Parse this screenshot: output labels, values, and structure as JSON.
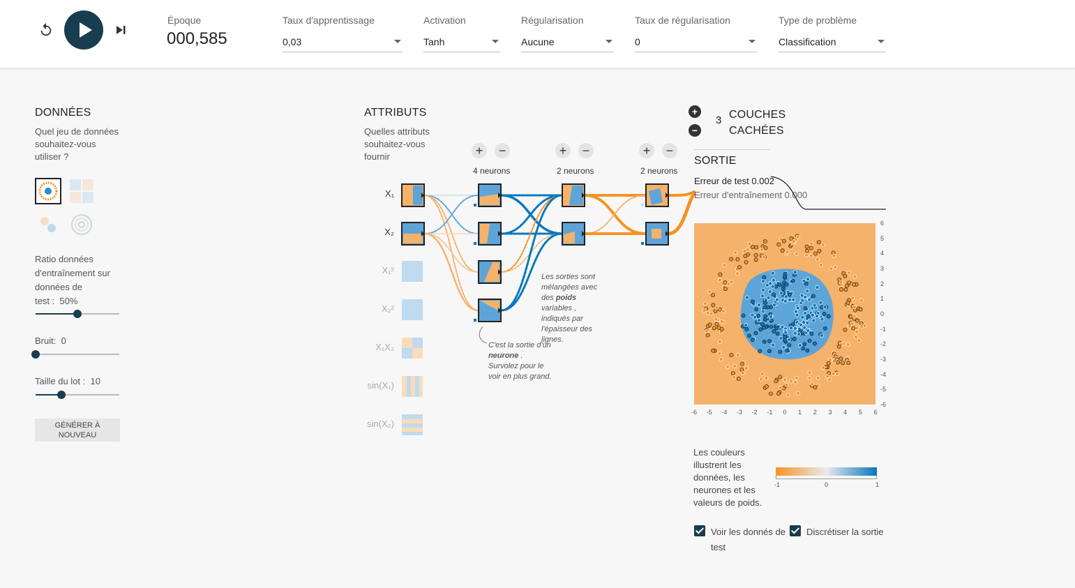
{
  "controls": {
    "epoch_label": "Époque",
    "epoch_value": "000,585",
    "learning_rate_label": "Taux d'apprentissage",
    "learning_rate_value": "0,03",
    "activation_label": "Activation",
    "activation_value": "Tanh",
    "regularization_label": "Régularisation",
    "regularization_value": "Aucune",
    "reg_rate_label": "Taux de régularisation",
    "reg_rate_value": "0",
    "problem_type_label": "Type de problème",
    "problem_type_value": "Classification"
  },
  "data_panel": {
    "title": "DONNÉES",
    "question": [
      "Quel jeu de données",
      "souhaitez-vous",
      "utiliser ?"
    ],
    "ratio_label": [
      "Ratio données",
      "d'entraînement sur",
      "données de"
    ],
    "ratio_prefix": "test :",
    "ratio_value": "50%",
    "ratio_fraction": 0.5,
    "noise_label": "Bruit:",
    "noise_value": "0",
    "noise_fraction": 0,
    "batch_label": "Taille du lot :",
    "batch_value": "10",
    "batch_fraction": 0.3,
    "regenerate_label": "GÉNÉRER À NOUVEAU"
  },
  "features_panel": {
    "title": "ATTRIBUTS",
    "question": [
      "Quelles attributs",
      "souhaitez-vous",
      "fournir"
    ],
    "features": [
      "X₁",
      "X₂",
      "X₁²",
      "X₂²",
      "X₁X₂",
      "sin(X₁)",
      "sin(X₂)"
    ]
  },
  "network": {
    "hidden_layers_count": "3",
    "hidden_layers_label": [
      "COUCHES",
      "CACHÉES"
    ],
    "layers": [
      {
        "neurons_label": "4 neurons"
      },
      {
        "neurons_label": "2 neurons"
      },
      {
        "neurons_label": "2 neurons"
      }
    ],
    "note_weights": [
      "Les sorties sont",
      "mélangées avec",
      "des",
      "poids",
      "variables ,",
      "indiqués par",
      "l'épaisseur des",
      "lignes."
    ],
    "note_neuron": [
      "C'est la sortie d'un",
      "neurone",
      ".",
      "Survolez pour le",
      "voir en plus grand."
    ]
  },
  "output_panel": {
    "title": "SORTIE",
    "test_loss_label": "Erreur de test",
    "test_loss_value": "0.002",
    "train_loss_label": "Erreur d'entraînement",
    "train_loss_value": "0.000",
    "x_ticks": [
      "-6",
      "-5",
      "-4",
      "-3",
      "-2",
      "-1",
      "0",
      "1",
      "2",
      "3",
      "4",
      "5",
      "6"
    ],
    "y_ticks": [
      "6",
      "5",
      "4",
      "3",
      "2",
      "1",
      "0",
      "-1",
      "-2",
      "-3",
      "-4",
      "-5",
      "-6"
    ],
    "legend_text": [
      "Les couleurs",
      "illustrent les",
      "données, les",
      "neurones et les",
      "valeurs de poids."
    ],
    "colorbar_ticks": [
      "-1",
      "0",
      "1"
    ],
    "show_test_label": "Voir les donnés de",
    "show_test_label2": "test",
    "discretize_label": "Discrétiser la sortie",
    "colors": {
      "orange": "#f59322",
      "blue": "#0877bd",
      "light_orange": "#f5b26b",
      "light_blue": "#5da5d8"
    }
  }
}
